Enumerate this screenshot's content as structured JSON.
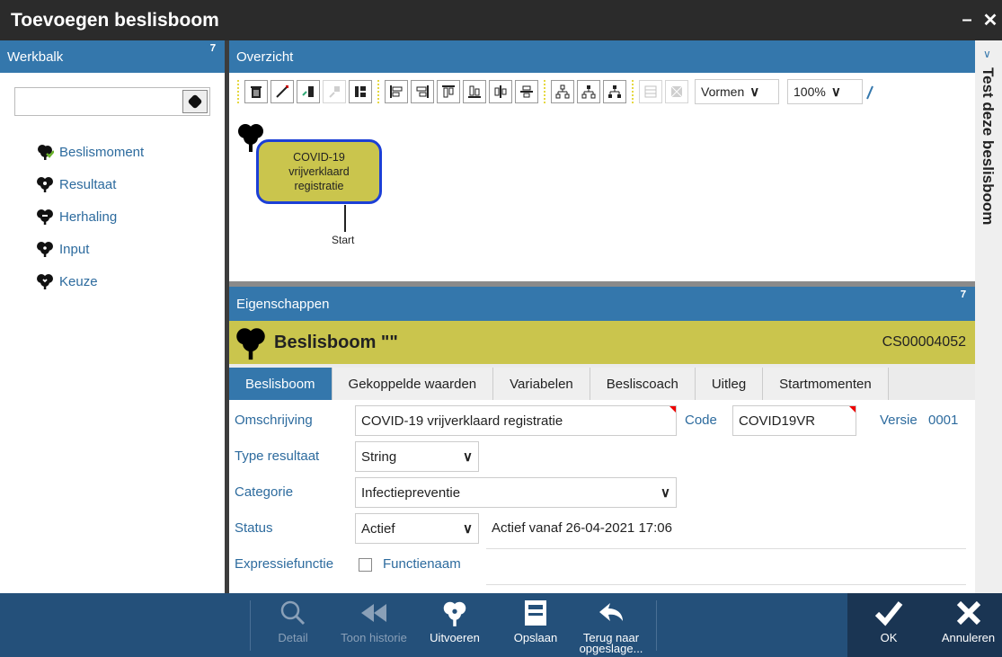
{
  "window": {
    "title": "Toevoegen beslisboom",
    "minimize": "–",
    "close": "✕"
  },
  "left_panel": {
    "title": "Werkbalk",
    "search": {
      "value": "",
      "placeholder": ""
    },
    "shapes": [
      {
        "label": "Beslismoment",
        "icon": "diamond-tree-icon"
      },
      {
        "label": "Resultaat",
        "icon": "tree-icon"
      },
      {
        "label": "Herhaling",
        "icon": "tree-icon"
      },
      {
        "label": "Input",
        "icon": "tree-icon"
      },
      {
        "label": "Keuze",
        "icon": "tree-icon"
      }
    ]
  },
  "overview": {
    "title": "Overzicht",
    "shapes_select": "Vormen",
    "zoom_select": "100%",
    "node": {
      "line1": "COVID-19",
      "line2": "vrijverklaard",
      "line3": "registratie"
    },
    "start_label": "Start"
  },
  "right_strip": {
    "label": "Test deze beslisboom"
  },
  "properties": {
    "title": "Eigenschappen",
    "banner_title": "Beslisboom \"\"",
    "banner_code": "CS00004052",
    "tabs": [
      "Beslisboom",
      "Gekoppelde waarden",
      "Variabelen",
      "Besliscoach",
      "Uitleg",
      "Startmomenten"
    ],
    "fields": {
      "omschrijving_label": "Omschrijving",
      "omschrijving_value": "COVID-19 vrijverklaard registratie",
      "code_label": "Code",
      "code_value": "COVID19VR",
      "versie_label": "Versie",
      "versie_value": "0001",
      "type_label": "Type resultaat",
      "type_value": "String",
      "categorie_label": "Categorie",
      "categorie_value": "Infectiepreventie",
      "status_label": "Status",
      "status_value": "Actief",
      "status_info": "Actief vanaf 26-04-2021 17:06",
      "expressie_label": "Expressiefunctie",
      "functienaam_label": "Functienaam"
    }
  },
  "bottom_bar": {
    "detail": "Detail",
    "toon_historie": "Toon historie",
    "uitvoeren": "Uitvoeren",
    "opslaan": "Opslaan",
    "terug_line1": "Terug naar",
    "terug_line2": "opgeslage...",
    "ok": "OK",
    "annuleren": "Annuleren"
  },
  "colors": {
    "accent": "#3477ac",
    "node_fill": "#cac54d",
    "node_border": "#1c3fd6",
    "bottom": "#24507a"
  }
}
